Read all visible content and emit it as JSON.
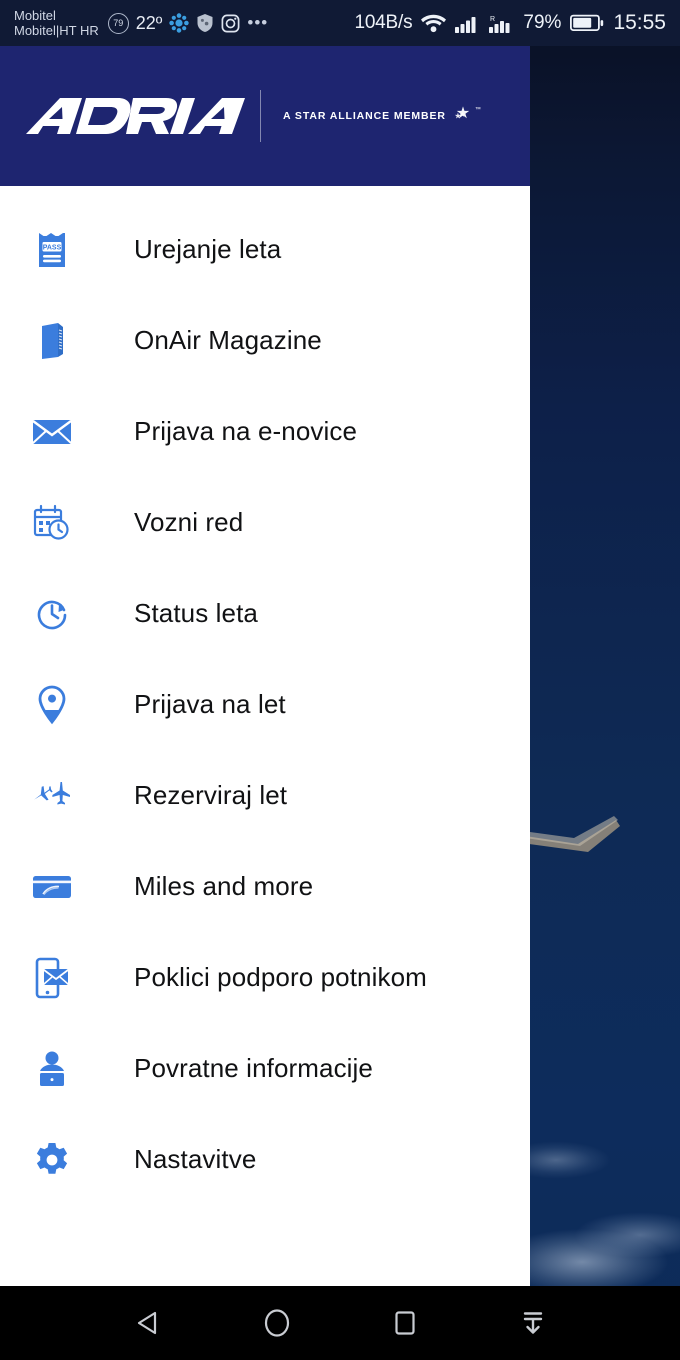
{
  "status_bar": {
    "carrier_line1": "Mobitel",
    "carrier_line2": "Mobitel|HT HR",
    "badge_number": "79",
    "temperature": "22º",
    "overflow_dots": "•••",
    "network_speed": "104B/s",
    "battery_percent": "79%",
    "clock": "15:55",
    "icons": [
      "battery-saver-badge-icon",
      "weather-icon",
      "shield-icon",
      "instagram-icon",
      "overflow-dots-icon",
      "wifi-icon",
      "signal-bars-icon",
      "signal-bars-roaming-icon",
      "battery-icon"
    ],
    "background_color": "#101a35"
  },
  "drawer": {
    "header": {
      "brand": "ADRIA",
      "alliance_text": "A STAR ALLIANCE MEMBER",
      "trademark": "™",
      "background_color": "#1e2570"
    },
    "accent_color": "#3b7ddd",
    "items": [
      {
        "label": "Urejanje leta",
        "icon": "boarding-pass-icon",
        "icon_text": "PASS"
      },
      {
        "label": "OnAir Magazine",
        "icon": "magazine-book-icon"
      },
      {
        "label": "Prijava na e-novice",
        "icon": "envelope-icon"
      },
      {
        "label": "Vozni red",
        "icon": "calendar-clock-icon"
      },
      {
        "label": "Status leta",
        "icon": "clock-refresh-icon"
      },
      {
        "label": "Prijava na let",
        "icon": "map-pin-icon"
      },
      {
        "label": "Rezerviraj let",
        "icon": "two-planes-icon"
      },
      {
        "label": "Miles and more",
        "icon": "credit-card-icon"
      },
      {
        "label": "Poklici podporo potnikom",
        "icon": "phone-message-icon"
      },
      {
        "label": "Povratne informacije",
        "icon": "person-feedback-icon"
      },
      {
        "label": "Nastavitve",
        "icon": "gear-icon"
      }
    ]
  },
  "navigation_bar": {
    "background_color": "#000000",
    "buttons": [
      {
        "name": "back-button",
        "icon": "back-triangle-icon"
      },
      {
        "name": "home-button",
        "icon": "home-circle-icon"
      },
      {
        "name": "recents-button",
        "icon": "recents-square-icon"
      },
      {
        "name": "hide-navbar-button",
        "icon": "hide-navbar-arrow-icon"
      }
    ]
  },
  "background": {
    "description": "night sky with airplane wing and clouds",
    "sky_color_top": "#090f22",
    "sky_color_bottom": "#0d2b58"
  }
}
